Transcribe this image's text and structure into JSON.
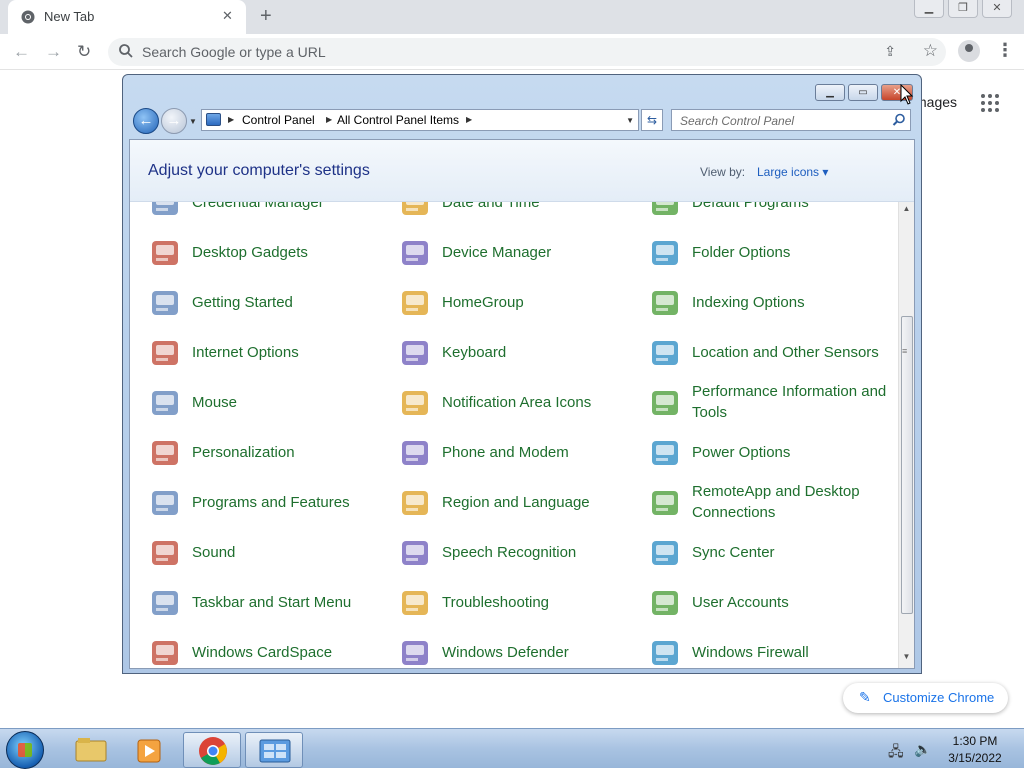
{
  "browser": {
    "tab_title": "New Tab",
    "tab_close": "✕",
    "new_tab": "+",
    "omnibox_placeholder": "Search Google or type a URL",
    "images_link": "mages",
    "customize_label": "Customize Chrome"
  },
  "window": {
    "breadcrumb": [
      "Control Panel",
      "All Control Panel Items"
    ],
    "search_placeholder": "Search Control Panel",
    "heading": "Adjust your computer's settings",
    "view_by_label": "View by:",
    "view_by_value": "Large icons"
  },
  "items": [
    {
      "label": "Credential Manager",
      "icon": "credential-manager-icon"
    },
    {
      "label": "Date and Time",
      "icon": "date-time-icon"
    },
    {
      "label": "Default Programs",
      "icon": "default-programs-icon"
    },
    {
      "label": "Desktop Gadgets",
      "icon": "desktop-gadgets-icon"
    },
    {
      "label": "Device Manager",
      "icon": "device-manager-icon"
    },
    {
      "label": "Folder Options",
      "icon": "folder-options-icon"
    },
    {
      "label": "Getting Started",
      "icon": "getting-started-icon"
    },
    {
      "label": "HomeGroup",
      "icon": "homegroup-icon"
    },
    {
      "label": "Indexing Options",
      "icon": "indexing-options-icon"
    },
    {
      "label": "Internet Options",
      "icon": "internet-options-icon"
    },
    {
      "label": "Keyboard",
      "icon": "keyboard-icon"
    },
    {
      "label": "Location and Other Sensors",
      "icon": "location-sensors-icon"
    },
    {
      "label": "Mouse",
      "icon": "mouse-icon"
    },
    {
      "label": "Notification Area Icons",
      "icon": "notification-area-icon"
    },
    {
      "label": "Performance Information and Tools",
      "icon": "performance-icon"
    },
    {
      "label": "Personalization",
      "icon": "personalization-icon"
    },
    {
      "label": "Phone and Modem",
      "icon": "phone-modem-icon"
    },
    {
      "label": "Power Options",
      "icon": "power-options-icon"
    },
    {
      "label": "Programs and Features",
      "icon": "programs-features-icon"
    },
    {
      "label": "Region and Language",
      "icon": "region-language-icon"
    },
    {
      "label": "RemoteApp and Desktop Connections",
      "icon": "remoteapp-icon"
    },
    {
      "label": "Sound",
      "icon": "sound-icon"
    },
    {
      "label": "Speech Recognition",
      "icon": "speech-recognition-icon"
    },
    {
      "label": "Sync Center",
      "icon": "sync-center-icon"
    },
    {
      "label": "Taskbar and Start Menu",
      "icon": "taskbar-start-icon"
    },
    {
      "label": "Troubleshooting",
      "icon": "troubleshooting-icon"
    },
    {
      "label": "User Accounts",
      "icon": "user-accounts-icon"
    },
    {
      "label": "Windows CardSpace",
      "icon": "cardspace-icon"
    },
    {
      "label": "Windows Defender",
      "icon": "windows-defender-icon"
    },
    {
      "label": "Windows Firewall",
      "icon": "windows-firewall-icon"
    }
  ],
  "taskbar": {
    "time": "1:30 PM",
    "date": "3/15/2022"
  },
  "colors": {
    "link_green": "#1e6f2e",
    "heading_blue": "#1e3287",
    "chrome_blue": "#1a73e8"
  }
}
